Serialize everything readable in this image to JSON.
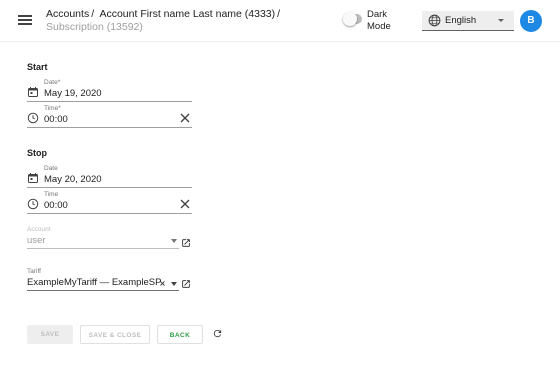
{
  "header": {
    "breadcrumb": {
      "accounts": "Accounts",
      "account_name": "Account First name Last name (4333)",
      "separator": "/",
      "subscription": "Subscription",
      "subscription_id": "(13592)"
    },
    "dark_mode_label": "Dark Mode",
    "dark_mode_on": false,
    "language": "English",
    "avatar_initial": "B"
  },
  "form": {
    "start": {
      "title": "Start",
      "date_label": "Date*",
      "date_value": "May 19, 2020",
      "time_label": "Time*",
      "time_value": "00:00"
    },
    "stop": {
      "title": "Stop",
      "date_label": "Date",
      "date_value": "May 20, 2020",
      "time_label": "Time",
      "time_value": "00:00"
    },
    "account": {
      "label": "Account",
      "value": "user"
    },
    "tariff": {
      "label": "Tariff",
      "value": "ExampleMyTariff — ExampleSP"
    }
  },
  "actions": {
    "save": "SAVE",
    "save_close": "SAVE & CLOSE",
    "back": "BACK"
  },
  "colors": {
    "accent": "#1e88e5",
    "back_button": "#2e9e44",
    "disabled_text": "#bdbdbd"
  }
}
